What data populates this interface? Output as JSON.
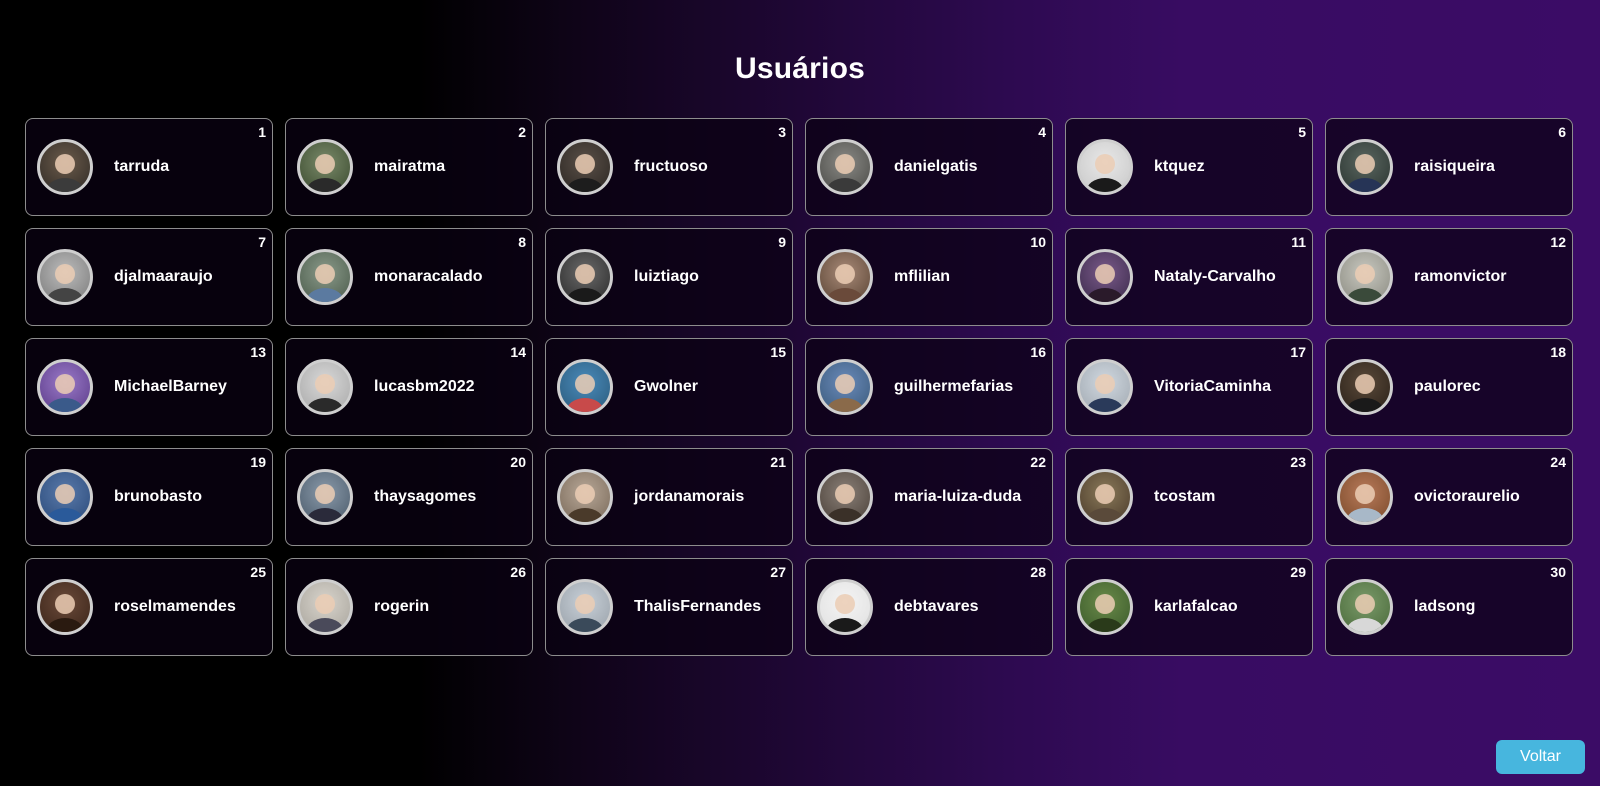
{
  "page": {
    "title": "Usuários"
  },
  "users": [
    {
      "rank": "1",
      "name": "tarruda",
      "avatar_colors": [
        "#6b5b4b",
        "#2f2a25",
        "#3b3b3b"
      ]
    },
    {
      "rank": "2",
      "name": "mairatma",
      "avatar_colors": [
        "#7a8a6a",
        "#3a4a2e",
        "#2a2a2a"
      ]
    },
    {
      "rank": "3",
      "name": "fructuoso",
      "avatar_colors": [
        "#5a5048",
        "#2b2622",
        "#1d1d1d"
      ]
    },
    {
      "rank": "4",
      "name": "danielgatis",
      "avatar_colors": [
        "#8a8a86",
        "#4a4a46",
        "#3a3a3a"
      ]
    },
    {
      "rank": "5",
      "name": "ktquez",
      "avatar_colors": [
        "#e8e8e8",
        "#c8c8c8",
        "#1a1a1a"
      ]
    },
    {
      "rank": "6",
      "name": "raisiqueira",
      "avatar_colors": [
        "#5a6660",
        "#2a3430",
        "#263456"
      ]
    },
    {
      "rank": "7",
      "name": "djalmaaraujo",
      "avatar_colors": [
        "#bcbcbc",
        "#7a7a7a",
        "#444444"
      ]
    },
    {
      "rank": "8",
      "name": "monaracalado",
      "avatar_colors": [
        "#8a9a8a",
        "#4a5a4a",
        "#5b7aa0"
      ]
    },
    {
      "rank": "9",
      "name": "luiztiago",
      "avatar_colors": [
        "#6a6a6a",
        "#2a2a2a",
        "#1a1a1a"
      ]
    },
    {
      "rank": "10",
      "name": "mflilian",
      "avatar_colors": [
        "#a88a78",
        "#5a4434",
        "#6a4a3a"
      ]
    },
    {
      "rank": "11",
      "name": "Nataly-Carvalho",
      "avatar_colors": [
        "#7a5a8a",
        "#3a2a4a",
        "#2a1a2a"
      ]
    },
    {
      "rank": "12",
      "name": "ramonvictor",
      "avatar_colors": [
        "#c8c8c0",
        "#8a8a80",
        "#3a4a3a"
      ]
    },
    {
      "rank": "13",
      "name": "MichaelBarney",
      "avatar_colors": [
        "#9a7ac8",
        "#5a3a88",
        "#3a5a8a"
      ]
    },
    {
      "rank": "14",
      "name": "lucasbm2022",
      "avatar_colors": [
        "#d8d8d8",
        "#a8a8a8",
        "#2a2a2a"
      ]
    },
    {
      "rank": "15",
      "name": "Gwolner",
      "avatar_colors": [
        "#4a8aba",
        "#2a5a7a",
        "#c84a4a"
      ]
    },
    {
      "rank": "16",
      "name": "guilhermefarias",
      "avatar_colors": [
        "#6a8aba",
        "#3a5a7a",
        "#8a6a4a"
      ]
    },
    {
      "rank": "17",
      "name": "VitoriaCaminha",
      "avatar_colors": [
        "#d0d8e0",
        "#a0a8b0",
        "#2a3a5a"
      ]
    },
    {
      "rank": "18",
      "name": "paulorec",
      "avatar_colors": [
        "#5a4a3a",
        "#2a2018",
        "#1a1a1a"
      ]
    },
    {
      "rank": "19",
      "name": "brunobasto",
      "avatar_colors": [
        "#5a7aaa",
        "#2a4a7a",
        "#2a5a9a"
      ]
    },
    {
      "rank": "20",
      "name": "thaysagomes",
      "avatar_colors": [
        "#8a9aaa",
        "#4a5a6a",
        "#2a2a3a"
      ]
    },
    {
      "rank": "21",
      "name": "jordanamorais",
      "avatar_colors": [
        "#b8a898",
        "#786858",
        "#4a3a2a"
      ]
    },
    {
      "rank": "22",
      "name": "maria-luiza-duda",
      "avatar_colors": [
        "#8a8078",
        "#4a4038",
        "#3a3028"
      ]
    },
    {
      "rank": "23",
      "name": "tcostam",
      "avatar_colors": [
        "#8a7a5a",
        "#4a3a2a",
        "#5a4a3a"
      ]
    },
    {
      "rank": "24",
      "name": "ovictoraurelio",
      "avatar_colors": [
        "#b87a5a",
        "#7a4a2a",
        "#a8b8c8"
      ]
    },
    {
      "rank": "25",
      "name": "roselmamendes",
      "avatar_colors": [
        "#6a4a3a",
        "#3a2418",
        "#2a1a10"
      ]
    },
    {
      "rank": "26",
      "name": "rogerin",
      "avatar_colors": [
        "#d8d4cc",
        "#a8a49c",
        "#4a4a5a"
      ]
    },
    {
      "rank": "27",
      "name": "ThalisFernandes",
      "avatar_colors": [
        "#c8d0d8",
        "#98a0a8",
        "#3a4a5a"
      ]
    },
    {
      "rank": "28",
      "name": "debtavares",
      "avatar_colors": [
        "#f4f4f4",
        "#e0e0e0",
        "#1a1a1a"
      ]
    },
    {
      "rank": "29",
      "name": "karlafalcao",
      "avatar_colors": [
        "#6a8a4a",
        "#3a5a2a",
        "#2a3a1a"
      ]
    },
    {
      "rank": "30",
      "name": "ladsong",
      "avatar_colors": [
        "#7a9a6a",
        "#4a6a3a",
        "#d8d8d8"
      ]
    }
  ],
  "actions": {
    "back_label": "Voltar"
  }
}
